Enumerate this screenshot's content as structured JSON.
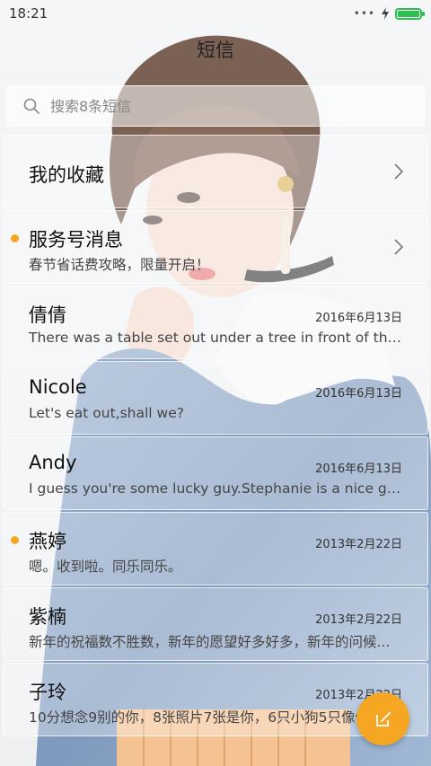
{
  "status_bar": {
    "time": "18:21",
    "dots": "•••"
  },
  "header": {
    "title": "短信"
  },
  "search": {
    "placeholder": "搜索8条短信"
  },
  "favorites": {
    "label": "我的收藏"
  },
  "service": {
    "label": "服务号消息",
    "snippet": "春节省话费攻略，限量开启！",
    "unread": true
  },
  "conversations": [
    {
      "name": "倩倩",
      "date": "2016年6月13日",
      "snippet": "There was a table set out under a tree in front of the ho...",
      "unread": false
    },
    {
      "name": "Nicole",
      "date": "2016年6月13日",
      "snippet": "Let's eat out,shall we?",
      "unread": false
    },
    {
      "name": "Andy",
      "date": "2016年6月13日",
      "snippet": "I guess you're some lucky guy.Stephanie is a nice girl.",
      "unread": false
    },
    {
      "name": "燕婷",
      "date": "2013年2月22日",
      "snippet": "嗯。收到啦。同乐同乐。",
      "unread": true
    },
    {
      "name": "紫楠",
      "date": "2013年2月22日",
      "snippet": "新年的祝福数不胜数，新年的愿望好多好多，新年的问候...",
      "unread": false
    },
    {
      "name": "子玲",
      "date": "2013年2月22日",
      "snippet": "10分想念9别的你，8张照片7张是你，6只小狗5只像你",
      "unread": false
    }
  ],
  "colors": {
    "accent": "#f5a623",
    "battery": "#2ebd4f"
  },
  "icons": {
    "search": "search-icon",
    "compose": "compose-icon",
    "chevron": "chevron-right-icon",
    "charging": "charging-icon"
  }
}
